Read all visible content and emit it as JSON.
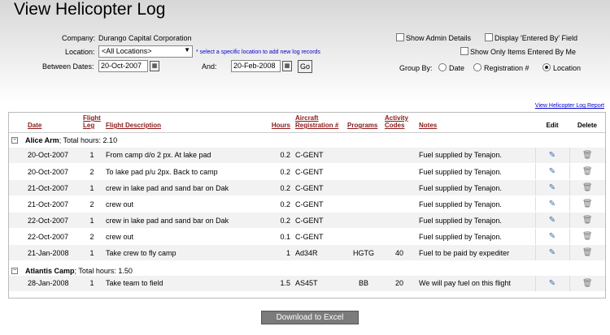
{
  "page": {
    "title": "View Helicopter Log"
  },
  "filters": {
    "company_label": "Company:",
    "company_value": "Durango Capital Corporation",
    "location_label": "Location:",
    "location_value": "<All Locations>",
    "location_hint": "select a specific location to add new log records",
    "between_label": "Between Dates:",
    "from_date": "20-Oct-2007",
    "and_label": "And:",
    "to_date": "20-Feb-2008",
    "go_label": "Go",
    "show_admin": "Show Admin Details",
    "display_entered_by": "Display 'Entered By' Field",
    "show_only_mine": "Show Only Items Entered By Me",
    "group_by_label": "Group By:",
    "group_options": [
      "Date",
      "Registration #",
      "Location"
    ],
    "group_selected": "Location"
  },
  "report_link": "View Helicopter Log Report",
  "table": {
    "headers": {
      "date": "Date",
      "flight_leg_1": "Flight",
      "flight_leg_2": "Leg",
      "description": "Flight Description",
      "hours": "Hours",
      "aircraft_1": "Aircraft",
      "aircraft_2": "Registration #",
      "programs": "Programs",
      "activity_1": "Activity",
      "activity_2": "Codes",
      "notes": "Notes",
      "edit": "Edit",
      "delete": "Delete"
    },
    "groups": [
      {
        "name": "Alice Arm",
        "total": "; Total hours: 2.10",
        "rows": [
          {
            "date": "20-Oct-2007",
            "leg": "1",
            "desc": "From camp d/o 2 px. At lake pad",
            "hours": "0.2",
            "reg": "C-GENT",
            "programs": "",
            "codes": "",
            "notes": "Fuel supplied by Tenajon."
          },
          {
            "date": "20-Oct-2007",
            "leg": "2",
            "desc": "To lake pad p/u 2px. Back to camp",
            "hours": "0.2",
            "reg": "C-GENT",
            "programs": "",
            "codes": "",
            "notes": "Fuel supplied by Tenajon."
          },
          {
            "date": "21-Oct-2007",
            "leg": "1",
            "desc": "crew in lake pad and sand bar on Dak",
            "hours": "0.2",
            "reg": "C-GENT",
            "programs": "",
            "codes": "",
            "notes": "Fuel supplied by Tenajon."
          },
          {
            "date": "21-Oct-2007",
            "leg": "2",
            "desc": "crew out",
            "hours": "0.2",
            "reg": "C-GENT",
            "programs": "",
            "codes": "",
            "notes": "Fuel supplied by Tenajon."
          },
          {
            "date": "22-Oct-2007",
            "leg": "1",
            "desc": "crew in lake pad and sand bar on Dak",
            "hours": "0.2",
            "reg": "C-GENT",
            "programs": "",
            "codes": "",
            "notes": "Fuel supplied by Tenajon."
          },
          {
            "date": "22-Oct-2007",
            "leg": "2",
            "desc": "crew out",
            "hours": "0.1",
            "reg": "C-GENT",
            "programs": "",
            "codes": "",
            "notes": "Fuel supplied by Tenajon."
          },
          {
            "date": "21-Jan-2008",
            "leg": "1",
            "desc": "Take crew to fly camp",
            "hours": "1",
            "reg": "Ad34R",
            "programs": "HGTG",
            "codes": "40",
            "notes": "Fuel to be paid by expediter"
          }
        ]
      },
      {
        "name": "Atlantis Camp",
        "total": "; Total hours: 1.50",
        "rows": [
          {
            "date": "28-Jan-2008",
            "leg": "1",
            "desc": "Take team to field",
            "hours": "1.5",
            "reg": "AS45T",
            "programs": "BB",
            "codes": "20",
            "notes": "We will pay fuel on this flight"
          }
        ]
      }
    ]
  },
  "download_label": "Download to Excel",
  "icons": {
    "edit": "pencil-icon",
    "delete": "trash-icon",
    "calendar": "calendar-icon"
  }
}
